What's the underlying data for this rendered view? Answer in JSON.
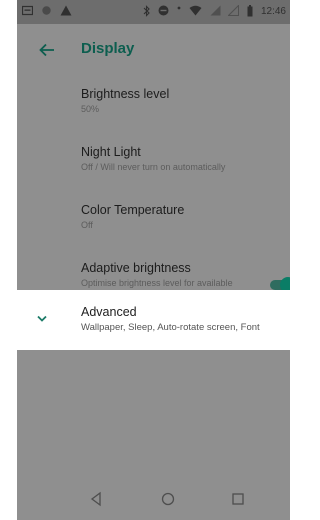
{
  "status_bar": {
    "time": "12:46",
    "left_icons": [
      "notification-box-icon",
      "circle-notification-icon",
      "warning-icon"
    ],
    "right_icons": [
      "bluetooth-icon",
      "do-not-disturb-icon",
      "vibrate-dot-icon",
      "wifi-icon",
      "cell-signal-icon",
      "cell-signal-2-icon",
      "battery-icon"
    ]
  },
  "app_bar": {
    "back_icon": "back-arrow-icon",
    "title": "Display"
  },
  "settings": {
    "brightness": {
      "title": "Brightness level",
      "summary": "50%"
    },
    "night_light": {
      "title": "Night Light",
      "summary": "Off / Will never turn on automatically"
    },
    "color_temperature": {
      "title": "Color Temperature",
      "summary": "Off"
    },
    "adaptive_brightness": {
      "title": "Adaptive brightness",
      "summary": "Optimise brightness level for available light",
      "enabled": true
    }
  },
  "advanced": {
    "icon": "chevron-down-icon",
    "title": "Advanced",
    "summary": "Wallpaper, Sleep, Auto-rotate screen, Font"
  },
  "nav_bar": {
    "buttons": [
      "back-triangle-icon",
      "home-circle-icon",
      "recents-square-icon"
    ]
  },
  "colors": {
    "accent": "#0a7d66",
    "title_accent": "#0d5e4f",
    "dim_overlay_background": "#8f8f8f",
    "status_bar": "#6d6d6d",
    "highlight_row": "#ffffff"
  }
}
